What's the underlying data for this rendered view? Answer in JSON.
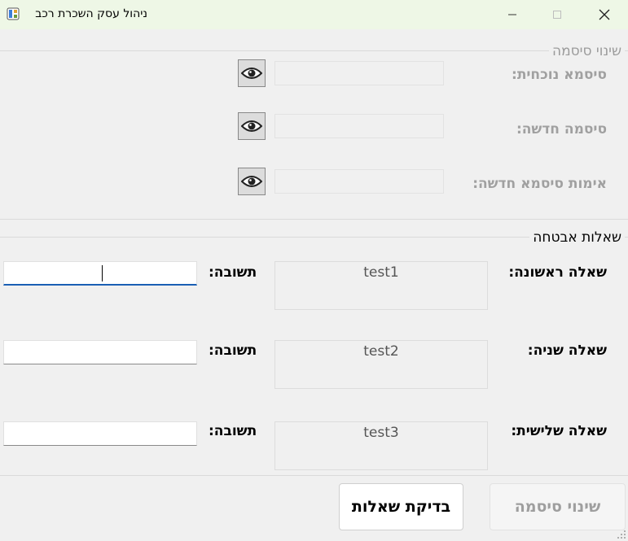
{
  "window": {
    "title": "ניהול עסק השכרת רכב"
  },
  "password_group": {
    "legend": "שינוי סיסמה",
    "current_label": "סיסמא נוכחית:",
    "new_label": "סיסמה חדשה:",
    "confirm_label": "אימות סיסמא חדשה:"
  },
  "security_group": {
    "legend": "שאלות אבטחה",
    "answer_label": "תשובה:",
    "questions": [
      {
        "label": "שאלה ראשונה:",
        "value": "test1"
      },
      {
        "label": "שאלה שניה:",
        "value": "test2"
      },
      {
        "label": "שאלה שלישית:",
        "value": "test3"
      }
    ]
  },
  "buttons": {
    "check": "בדיקת שאלות",
    "change": "שינוי סיסמה"
  },
  "colors": {
    "titlebar": "#eef7e6",
    "focus_accent": "#1a5fb4",
    "disabled_text": "#a0a0a0"
  }
}
